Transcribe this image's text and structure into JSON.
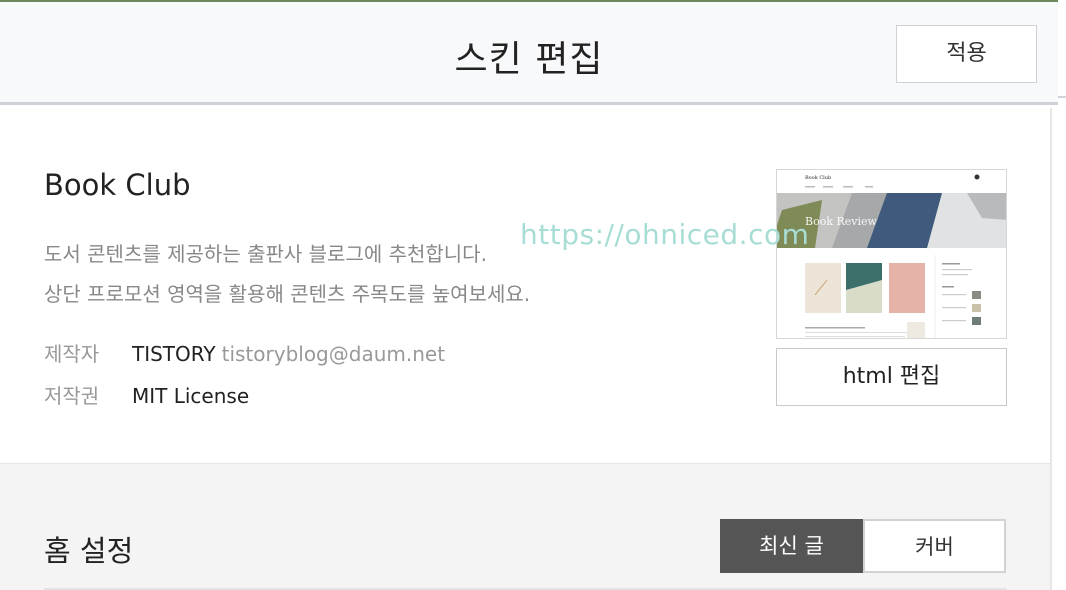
{
  "header": {
    "title": "스킨 편집",
    "apply_label": "적용"
  },
  "skin": {
    "name": "Book Club",
    "description_line1": "도서 콘텐츠를 제공하는 출판사 블로그에 추천합니다.",
    "description_line2": "상단 프로모션 영역을 활용해 콘텐츠 주목도를 높여보세요.",
    "author_label": "제작자",
    "author_name": "TISTORY",
    "author_email": "tistoryblog@daum.net",
    "license_label": "저작권",
    "license_value": "MIT License",
    "html_edit_label": "html 편집",
    "preview": {
      "blog_title": "Book Club",
      "banner_text": "Book Review"
    }
  },
  "watermark": "https://ohniced.com",
  "home": {
    "title": "홈 설정",
    "options": [
      {
        "label": "최신 글",
        "selected": true
      },
      {
        "label": "커버",
        "selected": false
      }
    ]
  },
  "colors": {
    "accent_line": "#6d8a5e",
    "selected_segment": "#555555",
    "watermark": "#a8ddd6"
  }
}
